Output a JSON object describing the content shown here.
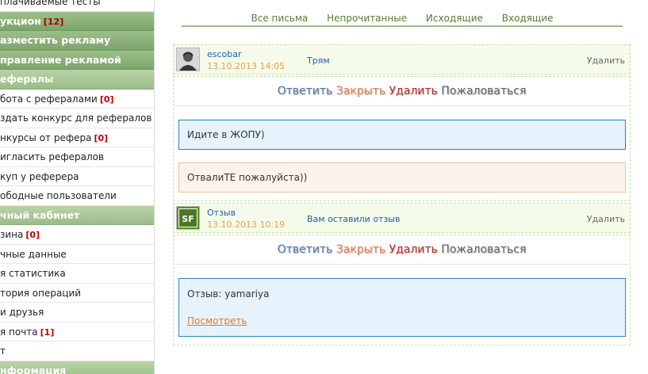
{
  "sidebar": {
    "items": [
      {
        "label": "плачиваемые тесты",
        "kind": "item"
      },
      {
        "label": "укцион",
        "count": "[12]",
        "kind": "head"
      },
      {
        "label": "азместить рекламу",
        "kind": "head"
      },
      {
        "label": "правление рекламой",
        "kind": "head"
      },
      {
        "label": "ефералы",
        "kind": "sub"
      },
      {
        "label": "бота с рефералами",
        "count": "[0]",
        "kind": "item"
      },
      {
        "label": "здать конкурс для рефералов",
        "kind": "item"
      },
      {
        "label": "нкурсы от рефера",
        "count": "[0]",
        "kind": "item"
      },
      {
        "label": "игласить рефералов",
        "kind": "item"
      },
      {
        "label": "куп у реферера",
        "kind": "item"
      },
      {
        "label": "ободные пользователи",
        "kind": "item"
      },
      {
        "label": "чный кабинет",
        "kind": "sub"
      },
      {
        "label": "зина",
        "count": "[0]",
        "kind": "item"
      },
      {
        "label": "чные данные",
        "kind": "item"
      },
      {
        "label": "я статистика",
        "kind": "item"
      },
      {
        "label": "тория операций",
        "kind": "item"
      },
      {
        "label": "и друзья",
        "kind": "item"
      },
      {
        "label": "я почта",
        "count": "[1]",
        "kind": "item"
      },
      {
        "label": "т",
        "kind": "item"
      },
      {
        "label": "нформация",
        "kind": "sub"
      }
    ]
  },
  "tabs": [
    "Все письма",
    "Непрочитанные",
    "Исходящие",
    "Входящие"
  ],
  "actions": {
    "reply": "Ответить",
    "close": "Закрыть",
    "delete": "Удалить",
    "report": "Пожаловаться"
  },
  "messages": [
    {
      "sender": "escobar",
      "date": "13.10.2013 14:05",
      "subject": "Трям",
      "delete_label": "Удалить",
      "reply_text": "Идите в ЖОПУ)",
      "original_text": "ОтвалиТЕ пожалуйста))"
    },
    {
      "sender": "Отзыв",
      "date": "13.10.2013 10:19",
      "subject": "Вам оставили отзыв",
      "delete_label": "Удалить",
      "avatar_text": "SF",
      "body_text": "Отзыв: yamariya",
      "view_link": "Посмотреть"
    }
  ],
  "colors": {
    "sidebar_header": "#8db37a",
    "tab_link": "#5a7a3a",
    "link_blue": "#1f5fa8",
    "date_orange": "#e8a04a"
  }
}
